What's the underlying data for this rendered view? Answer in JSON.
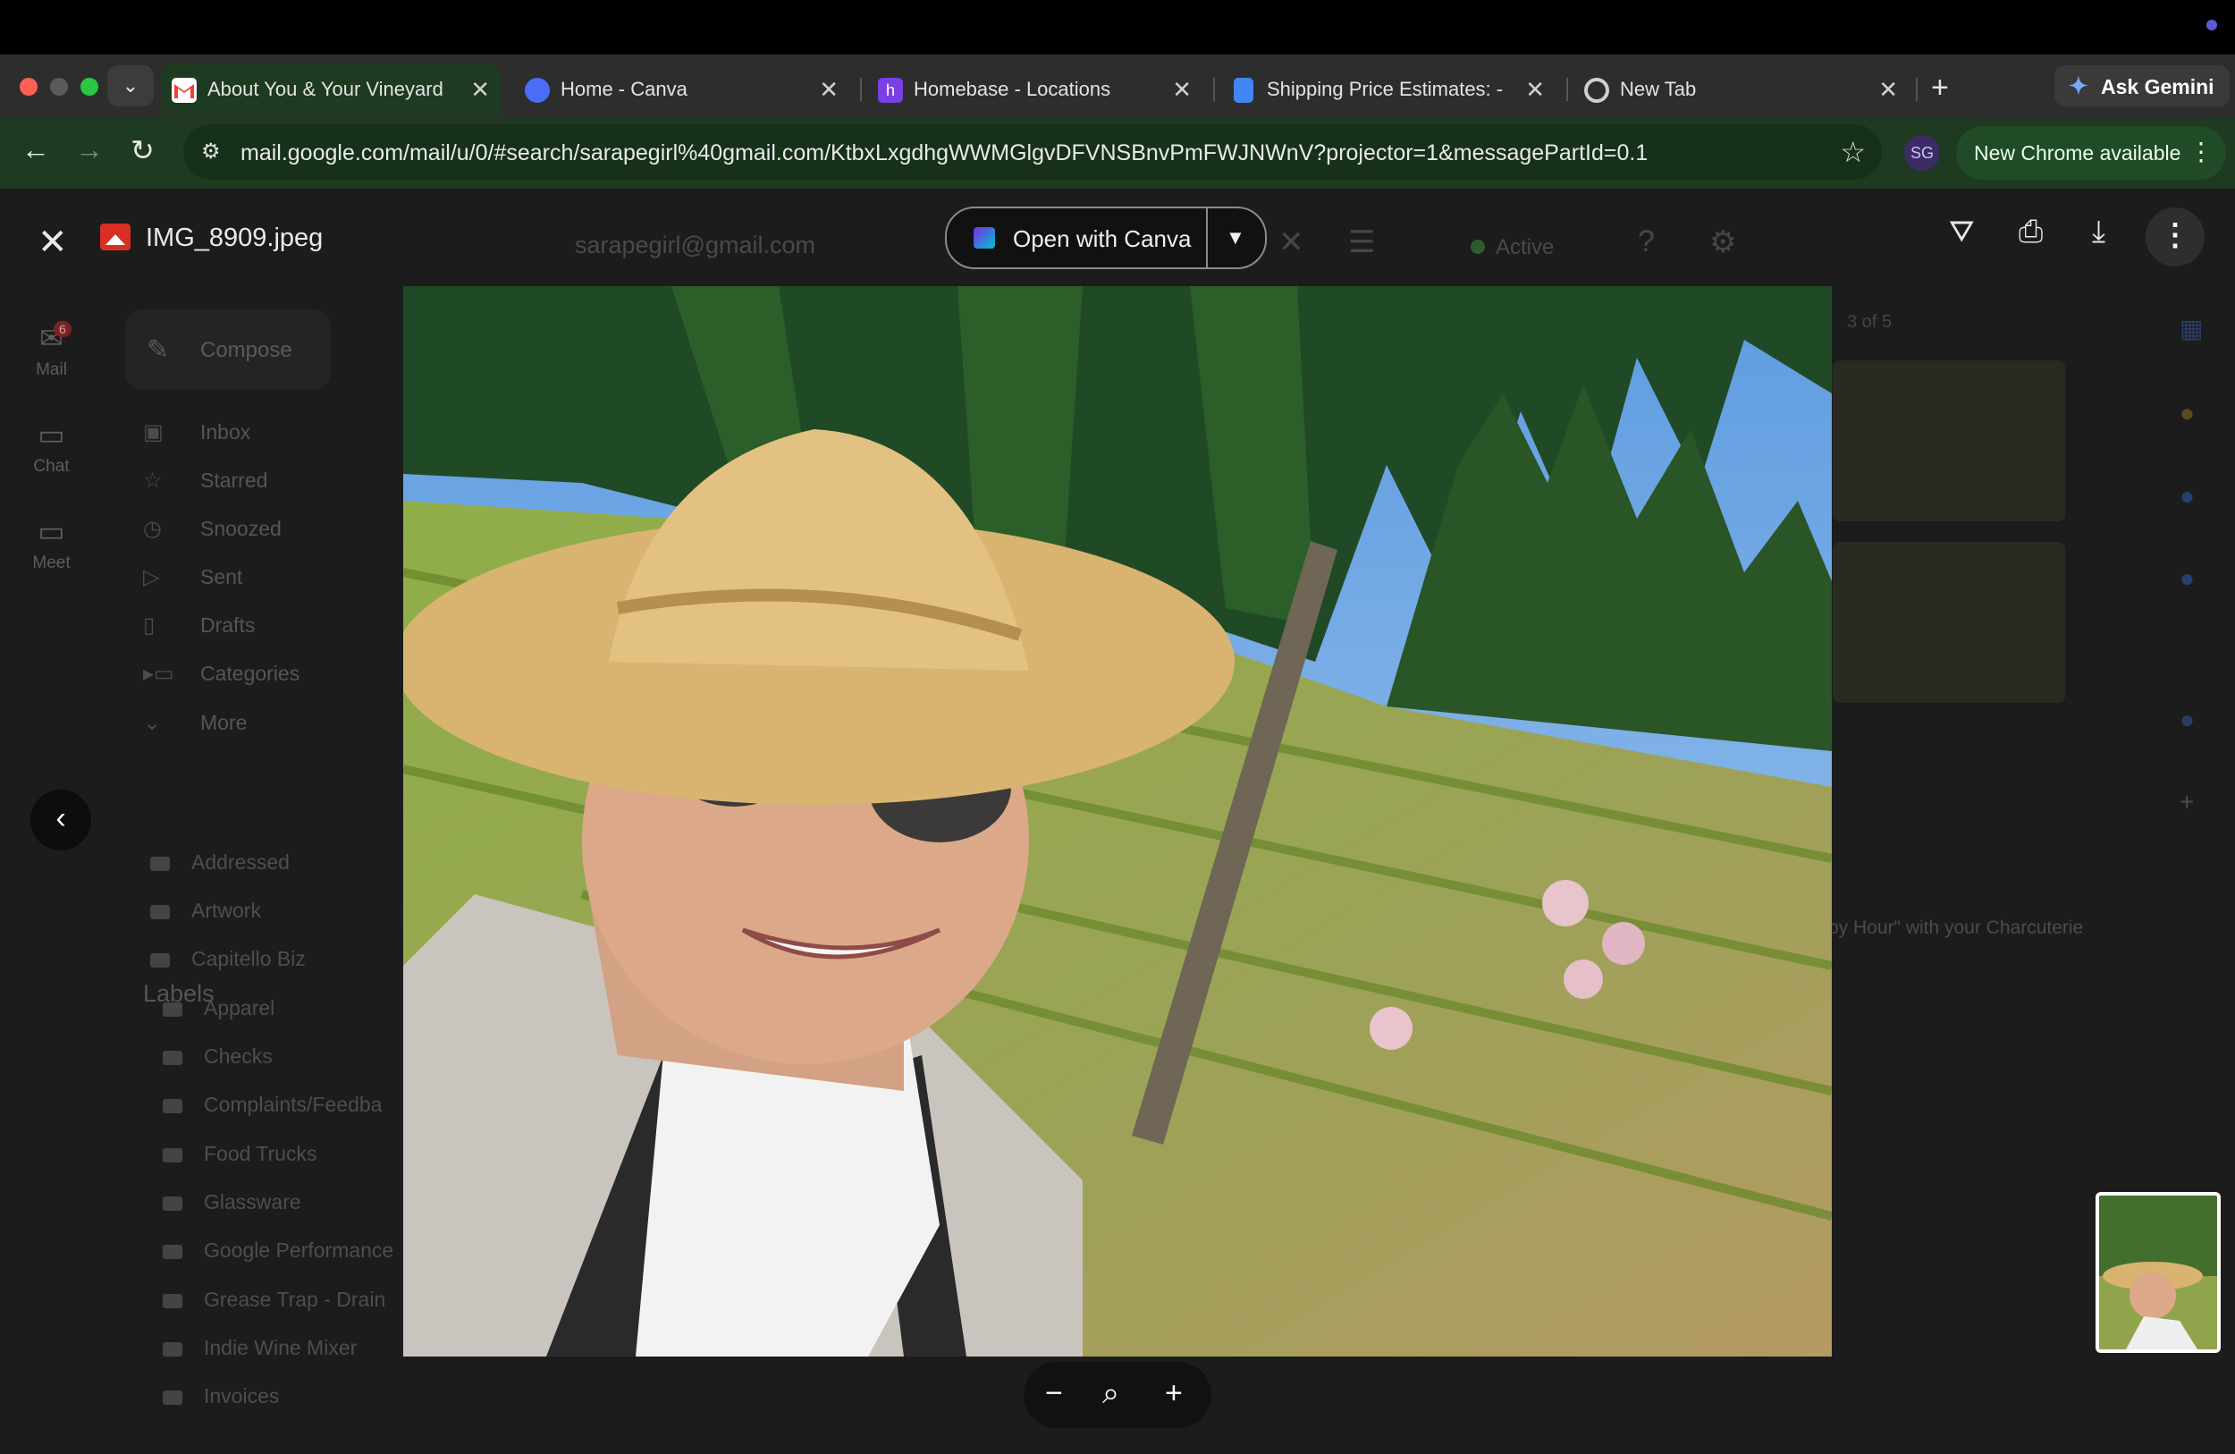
{
  "browser": {
    "tabs": [
      {
        "title": "About You & Your Vineyard -",
        "favicon": "gmail-icon",
        "active": true
      },
      {
        "title": "Home - Canva",
        "favicon": "canva-icon",
        "active": false
      },
      {
        "title": "Homebase - Locations",
        "favicon": "homebase-icon",
        "active": false
      },
      {
        "title": "Shipping Price Estimates: - (",
        "favicon": "docs-icon",
        "active": false
      },
      {
        "title": "New Tab",
        "favicon": "chrome-icon",
        "active": false
      }
    ],
    "gemini_label": "Ask Gemini",
    "url": "mail.google.com/mail/u/0/#search/sarapegirl%40gmail.com/KtbxLxgdhgWWMGlgvDFVNSBnvPmFWJNWnV?projector=1&messagePartId=0.1",
    "update_label": "New Chrome available"
  },
  "gmail": {
    "rail": [
      {
        "label": "Mail",
        "badge": "6"
      },
      {
        "label": "Chat"
      },
      {
        "label": "Meet"
      }
    ],
    "compose_label": "Compose",
    "search_text": "sarapegirl@gmail.com",
    "status": "Active",
    "nav": [
      "Inbox",
      "Starred",
      "Snoozed",
      "Sent",
      "Drafts",
      "Categories",
      "More"
    ],
    "labels_heading": "Labels",
    "labels": [
      "Addressed",
      "Artwork",
      "Capitello Biz",
      "Apparel",
      "Checks",
      "Complaints/Feedba",
      "Food Trucks",
      "Glassware",
      "Google Performance",
      "Grease Trap - Drain",
      "Indie Wine Mixer",
      "Invoices"
    ],
    "message_count": "3 of 5",
    "snippet": "py Hour\" with your Charcuterie"
  },
  "viewer": {
    "file_name": "IMG_8909.jpeg",
    "open_with_label": "Open with Canva"
  }
}
